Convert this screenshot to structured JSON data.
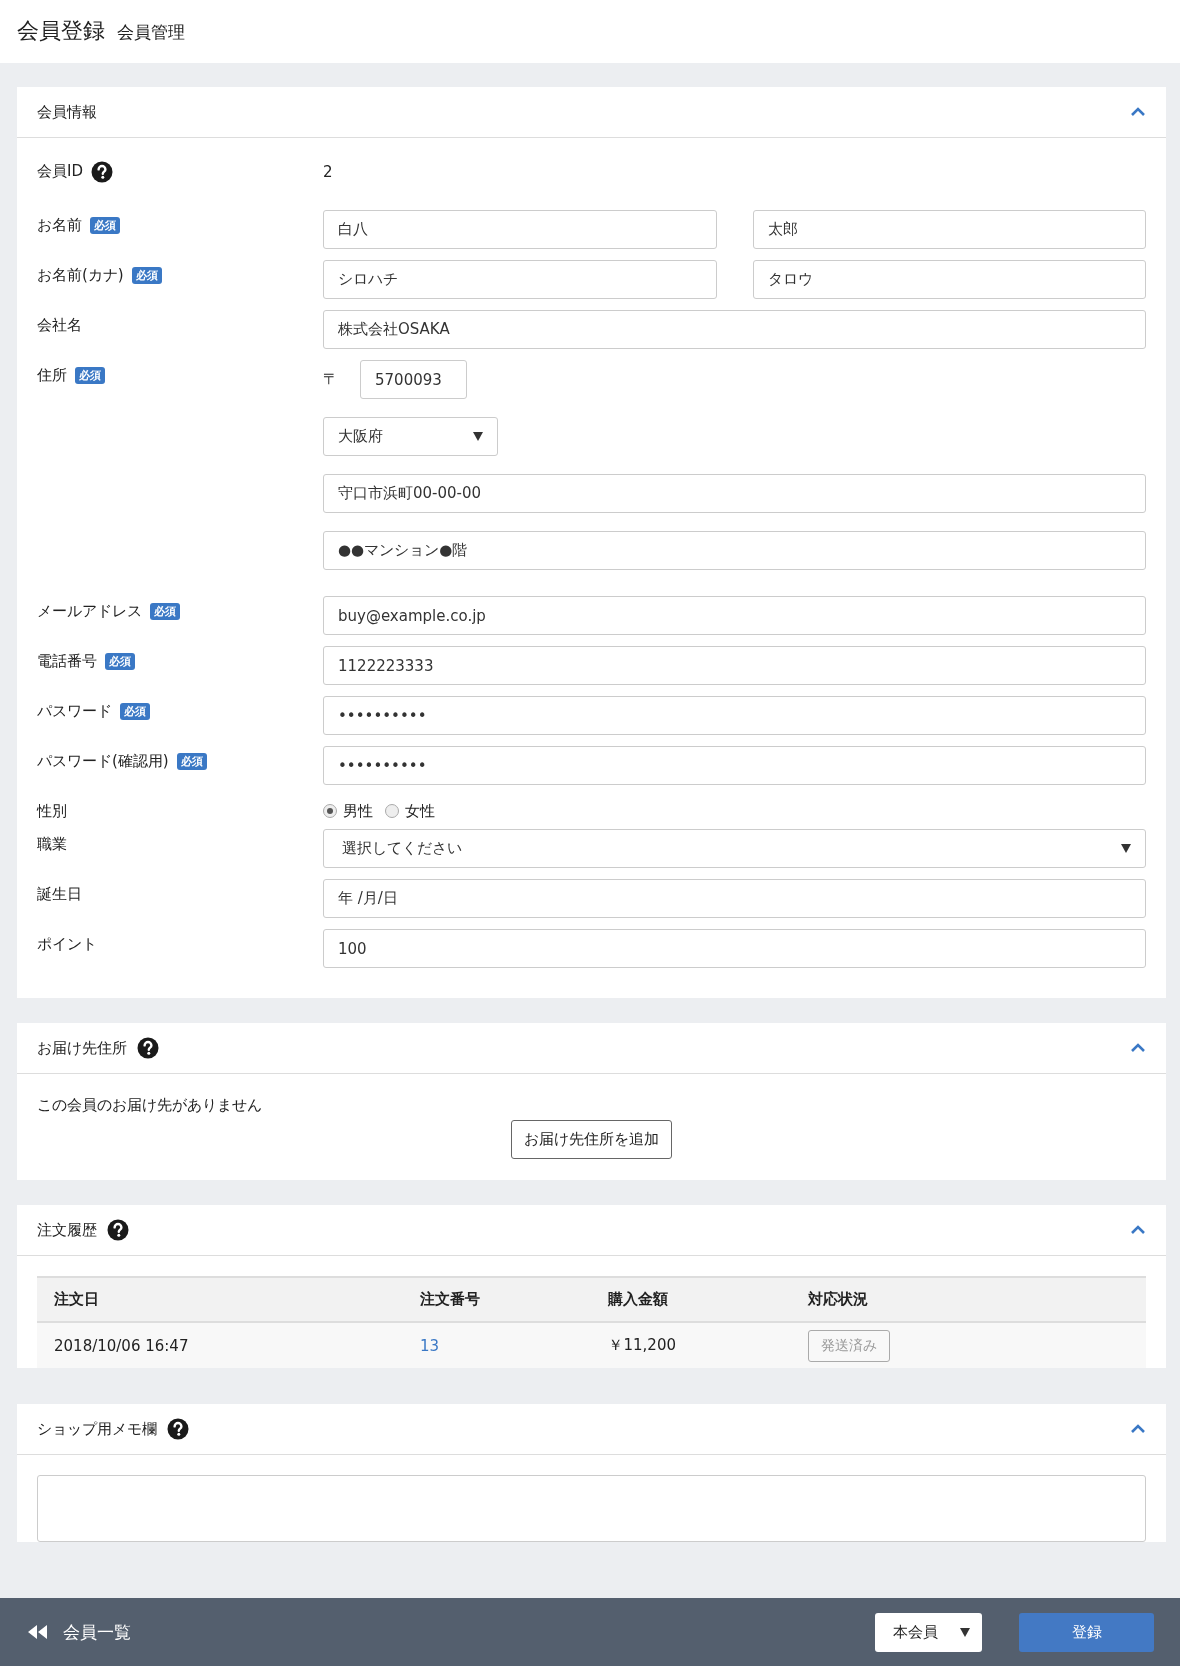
{
  "header": {
    "title": "会員登録",
    "subtitle": "会員管理"
  },
  "sections": [
    {
      "kind": "form",
      "title": "会員情報",
      "help": false,
      "expanded": true,
      "rows": [
        {
          "label": "会員ID",
          "help": true,
          "kind": "static",
          "value": "2"
        },
        {
          "label": "お名前",
          "help": false,
          "required_badge": "必須",
          "kind": "pair",
          "fields": [
            "白八",
            "太郎"
          ]
        },
        {
          "label": "お名前(カナ)",
          "help": false,
          "required_badge": "必須",
          "kind": "pair",
          "fields": [
            "シロハチ",
            "タロウ"
          ]
        },
        {
          "label": "会社名",
          "help": false,
          "kind": "text",
          "value": "株式会社OSAKA"
        },
        {
          "label": "住所",
          "help": false,
          "required_badge": "必須",
          "kind": "address",
          "postal_mark": "〒",
          "postal_code": "5700093",
          "prefecture": "大阪府",
          "lines": [
            "守口市浜町00-00-00",
            "●●マンション●階"
          ]
        },
        {
          "label": "メールアドレス",
          "help": false,
          "required_badge": "必須",
          "kind": "text",
          "value": "buy@example.co.jp"
        },
        {
          "label": "電話番号",
          "help": false,
          "required_badge": "必須",
          "kind": "text",
          "value": "1122223333"
        },
        {
          "label": "パスワード",
          "help": false,
          "required_badge": "必須",
          "kind": "text",
          "value": "••••••••••"
        },
        {
          "label": "パスワード(確認用)",
          "help": false,
          "required_badge": "必須",
          "kind": "text",
          "value": "••••••••••"
        },
        {
          "label": "性別",
          "help": false,
          "kind": "radio",
          "options": [
            {
              "label": "男性",
              "selected": true
            },
            {
              "label": "女性",
              "selected": false
            }
          ]
        },
        {
          "label": "職業",
          "help": false,
          "kind": "select",
          "value": "選択してください"
        },
        {
          "label": "誕生日",
          "help": false,
          "kind": "text",
          "value": "年 /月/日"
        },
        {
          "label": "ポイント",
          "help": false,
          "kind": "text",
          "value": "100"
        }
      ]
    },
    {
      "kind": "empty",
      "title": "お届け先住所",
      "help": true,
      "expanded": true,
      "message": "この会員のお届け先がありません",
      "button": "お届け先住所を追加"
    },
    {
      "kind": "table",
      "title": "注文履歴",
      "help": true,
      "expanded": true,
      "columns": [
        "注文日",
        "注文番号",
        "購入金額",
        "対応状況"
      ],
      "rows": [
        {
          "date": "2018/10/06 16:47",
          "order_number": "13",
          "amount": "￥11,200",
          "status": "発送済み"
        }
      ]
    },
    {
      "kind": "memo",
      "title": "ショップ用メモ欄",
      "help": true,
      "expanded": true
    }
  ],
  "footer": {
    "back": "会員一覧",
    "member_status": "本会員",
    "submit": "登録"
  }
}
